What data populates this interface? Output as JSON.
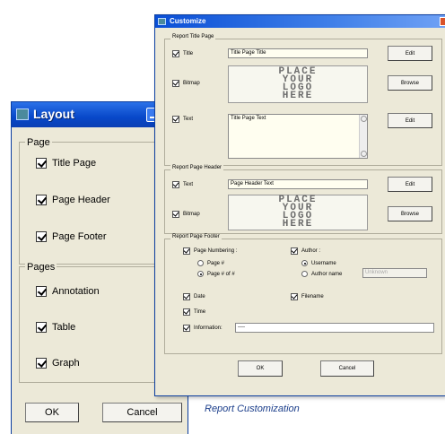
{
  "layout": {
    "title": "Layout",
    "groups": {
      "page": {
        "label": "Page",
        "items": [
          {
            "label": "Title Page",
            "checked": true
          },
          {
            "label": "Page Header",
            "checked": true
          },
          {
            "label": "Page Footer",
            "checked": true
          }
        ]
      },
      "pages": {
        "label": "Pages",
        "items": [
          {
            "label": "Annotation",
            "checked": true
          },
          {
            "label": "Table",
            "checked": true
          },
          {
            "label": "Graph",
            "checked": true
          }
        ]
      }
    },
    "ok_label": "OK",
    "cancel_label": "Cancel"
  },
  "customize": {
    "title": "Customize",
    "title_page": {
      "label": "Report Title Page",
      "title_check": "Title",
      "title_value": "Title Page Title",
      "bitmap_check": "Bitmap",
      "text_check": "Text",
      "text_value": "Title Page Text",
      "edit_label": "Edit",
      "browse_label": "Browse"
    },
    "page_header": {
      "label": "Report Page Header",
      "text_check": "Text",
      "text_value": "Page Header Text",
      "bitmap_check": "Bitmap",
      "edit_label": "Edit",
      "browse_label": "Browse"
    },
    "page_footer": {
      "label": "Report Page Footer",
      "page_numbering": "Page Numbering :",
      "page_num": "Page #",
      "page_num_of": "Page # of #",
      "author": "Author :",
      "username": "Username",
      "author_name": "Author name",
      "author_name_placeholder": "Unknown",
      "date": "Date",
      "filename": "Filename",
      "time": "Time",
      "information": "Information:",
      "information_value": "----"
    },
    "ok_label": "OK",
    "cancel_label": "Cancel"
  },
  "logo_lines": [
    "PLACE",
    "YOUR",
    "LOGO",
    "HERE"
  ],
  "caption": "Report Customization",
  "colors": {
    "title_gradient_start": "#0a4fd6",
    "title_gradient_end": "#6fa1f5",
    "dialog_bg": "#ece9d8",
    "close": "#d9532a"
  }
}
